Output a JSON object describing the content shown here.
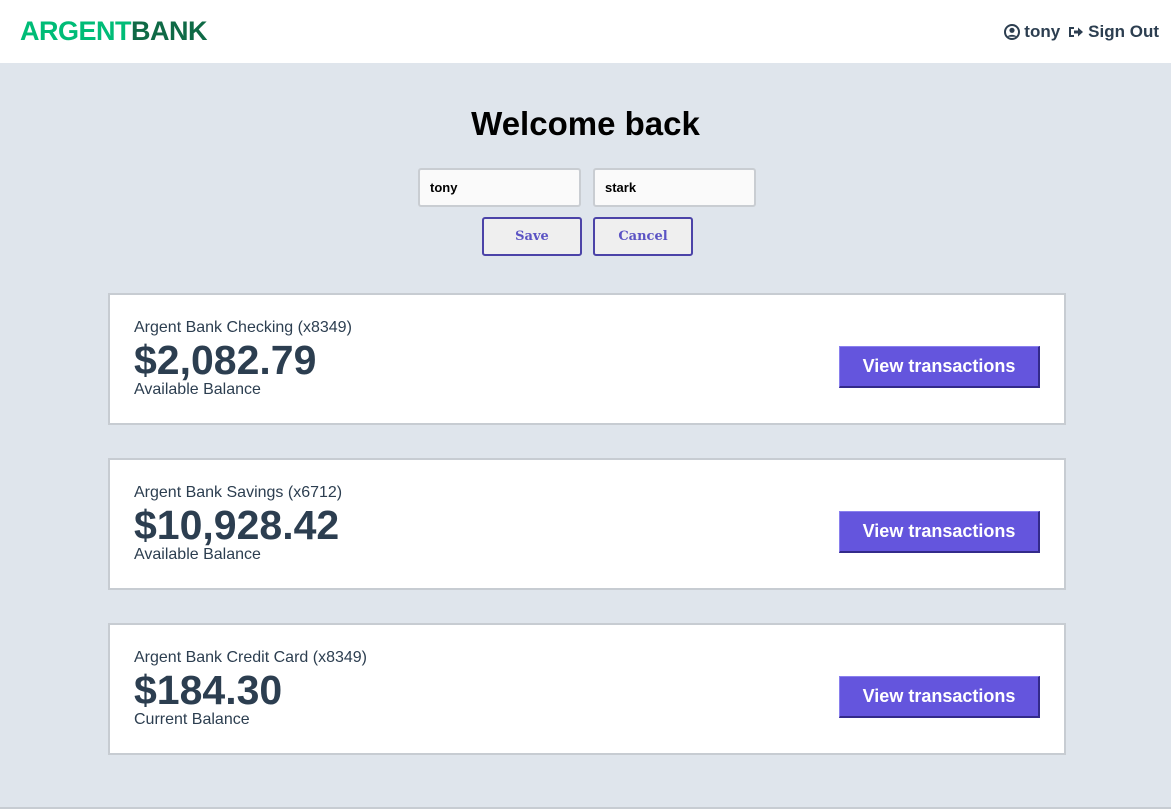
{
  "nav": {
    "logo_part1": "ARGENT",
    "logo_part2": "BANK",
    "username": "tony",
    "signout_label": "Sign Out"
  },
  "header": {
    "title": "Welcome back",
    "first_name_value": "tony",
    "last_name_value": "stark",
    "save_label": "Save",
    "cancel_label": "Cancel"
  },
  "accounts": [
    {
      "title": "Argent Bank Checking (x8349)",
      "amount": "$2,082.79",
      "description": "Available Balance",
      "button_label": "View transactions"
    },
    {
      "title": "Argent Bank Savings (x6712)",
      "amount": "$10,928.42",
      "description": "Available Balance",
      "button_label": "View transactions"
    },
    {
      "title": "Argent Bank Credit Card (x8349)",
      "amount": "$184.30",
      "description": "Current Balance",
      "button_label": "View transactions"
    }
  ],
  "colors": {
    "brand_green": "#00bc77",
    "brand_dark_green": "#0f6a46",
    "button_purple": "#6455dd",
    "background": "#dfe5ec"
  }
}
